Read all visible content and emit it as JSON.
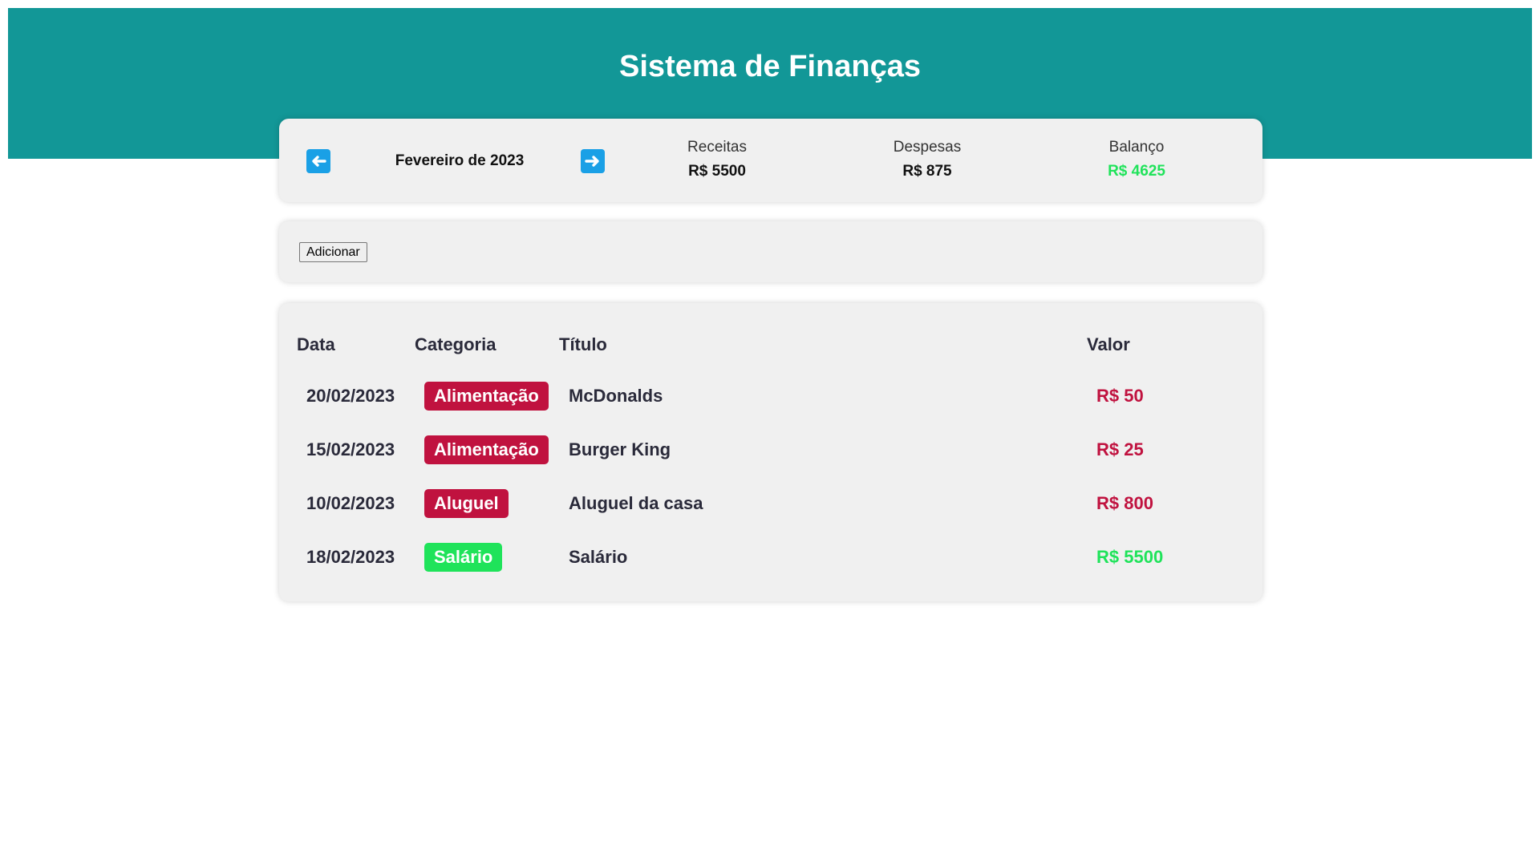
{
  "header": {
    "title": "Sistema de Finanças",
    "color": "#129797"
  },
  "info": {
    "month": "Fevereiro de 2023",
    "prev_icon": "arrow-left-icon",
    "next_icon": "arrow-right-icon",
    "receitas": {
      "label": "Receitas",
      "value": "R$ 5500"
    },
    "despesas": {
      "label": "Despesas",
      "value": "R$ 875"
    },
    "balanco": {
      "label": "Balanço",
      "value": "R$ 4625",
      "color": "#1fe35a"
    }
  },
  "actions": {
    "add_label": "Adicionar"
  },
  "table": {
    "headers": [
      "Data",
      "Categoria",
      "Título",
      "Valor"
    ],
    "rows": [
      {
        "date": "20/02/2023",
        "category": "Alimentação",
        "category_color": "#c0123f",
        "title": "McDonalds",
        "value": "R$ 50",
        "value_color": "#c0123f"
      },
      {
        "date": "15/02/2023",
        "category": "Alimentação",
        "category_color": "#c0123f",
        "title": "Burger King",
        "value": "R$ 25",
        "value_color": "#c0123f"
      },
      {
        "date": "10/02/2023",
        "category": "Aluguel",
        "category_color": "#c0123f",
        "title": "Aluguel da casa",
        "value": "R$ 800",
        "value_color": "#c0123f"
      },
      {
        "date": "18/02/2023",
        "category": "Salário",
        "category_color": "#1fe35a",
        "title": "Salário",
        "value": "R$ 5500",
        "value_color": "#1fe35a"
      }
    ]
  }
}
